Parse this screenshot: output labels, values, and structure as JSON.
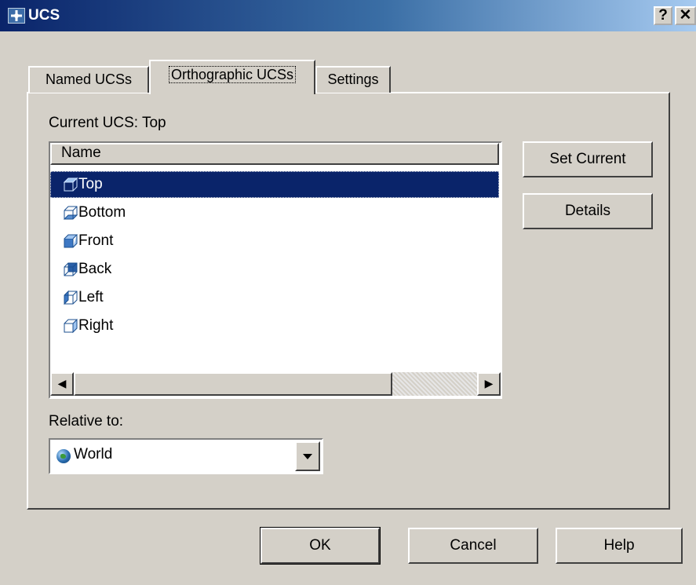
{
  "window": {
    "title": "UCS",
    "help_glyph": "?",
    "close_glyph": "✕"
  },
  "tabs": [
    {
      "label": "Named UCSs",
      "active": false
    },
    {
      "label": "Orthographic UCSs",
      "active": true
    },
    {
      "label": "Settings",
      "active": false
    }
  ],
  "current_ucs": {
    "label": "Current UCS:",
    "value": "Top"
  },
  "list": {
    "column_header": "Name",
    "items": [
      {
        "label": "Top",
        "icon": "ucs-top-icon",
        "selected": true
      },
      {
        "label": "Bottom",
        "icon": "ucs-bottom-icon",
        "selected": false
      },
      {
        "label": "Front",
        "icon": "ucs-front-icon",
        "selected": false
      },
      {
        "label": "Back",
        "icon": "ucs-back-icon",
        "selected": false
      },
      {
        "label": "Left",
        "icon": "ucs-left-icon",
        "selected": false
      },
      {
        "label": "Right",
        "icon": "ucs-right-icon",
        "selected": false
      }
    ]
  },
  "side_buttons": {
    "set_current": "Set Current",
    "details": "Details"
  },
  "relative_to": {
    "label": "Relative to:",
    "value": "World",
    "icon": "globe-icon"
  },
  "footer": {
    "ok": "OK",
    "cancel": "Cancel",
    "help": "Help"
  },
  "colors": {
    "selection": "#0a246a",
    "face": "#d4d0c8",
    "titlebar_start": "#0a246a",
    "titlebar_end": "#a6caf0"
  }
}
